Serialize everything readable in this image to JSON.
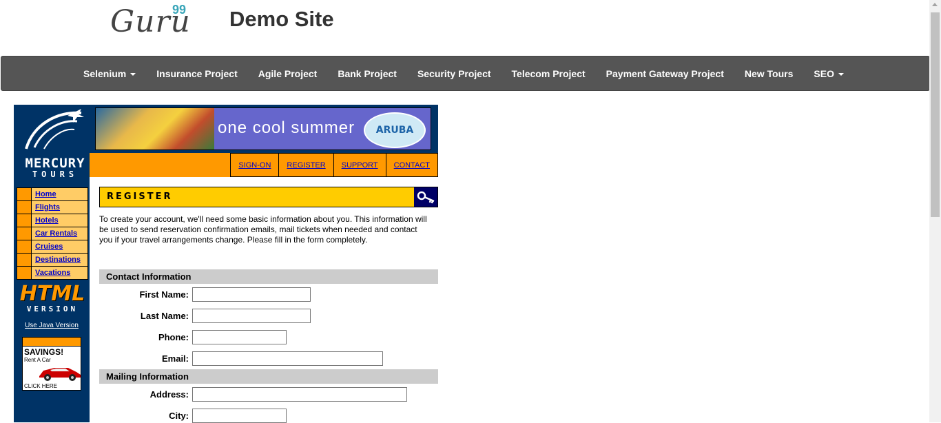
{
  "header": {
    "logo_text": "Guru",
    "logo_superscript": "99",
    "site_title": "Demo Site"
  },
  "navbar": {
    "items": [
      {
        "label": "Selenium",
        "dropdown": true
      },
      {
        "label": "Insurance Project",
        "dropdown": false
      },
      {
        "label": "Agile Project",
        "dropdown": false
      },
      {
        "label": "Bank Project",
        "dropdown": false
      },
      {
        "label": "Security Project",
        "dropdown": false
      },
      {
        "label": "Telecom Project",
        "dropdown": false
      },
      {
        "label": "Payment Gateway Project",
        "dropdown": false
      },
      {
        "label": "New Tours",
        "dropdown": false
      },
      {
        "label": "SEO",
        "dropdown": true
      }
    ]
  },
  "sidebar": {
    "logo_title": "MERCURY",
    "logo_subtitle": "TOURS",
    "items": [
      "Home",
      "Flights",
      "Hotels",
      "Car Rentals",
      "Cruises",
      "Destinations",
      "Vacations"
    ],
    "html_version_title": "HTML",
    "html_version_subtitle": "VERSION",
    "java_link": "Use Java Version",
    "ad": {
      "title": "SAVINGS!",
      "line": "Rent A Car",
      "cta": "CLICK HERE"
    }
  },
  "banner": {
    "text": "one cool summer",
    "badge": "ARUBA"
  },
  "top_links": [
    "SIGN-ON",
    "REGISTER",
    "SUPPORT",
    "CONTACT"
  ],
  "register": {
    "heading": "REGISTER",
    "intro": "To create your account, we'll need some basic information about you. This information will be used to send reservation confirmation emails, mail tickets when needed and contact you if your travel arrangements change. Please fill in the form completely."
  },
  "form": {
    "contact_section": "Contact Information",
    "first_name_label": "First Name:",
    "first_name_value": "",
    "last_name_label": "Last Name:",
    "last_name_value": "",
    "phone_label": "Phone:",
    "phone_value": "",
    "email_label": "Email:",
    "email_value": "",
    "mailing_section": "Mailing Information",
    "address_label": "Address:",
    "address_value": "",
    "city_label": "City:",
    "city_value": ""
  },
  "colors": {
    "navbar_bg": "#555555",
    "sidebar_bg": "#003366",
    "accent_orange": "#ff9900",
    "register_yellow": "#ffcc00",
    "link_blue": "#0000cc"
  }
}
